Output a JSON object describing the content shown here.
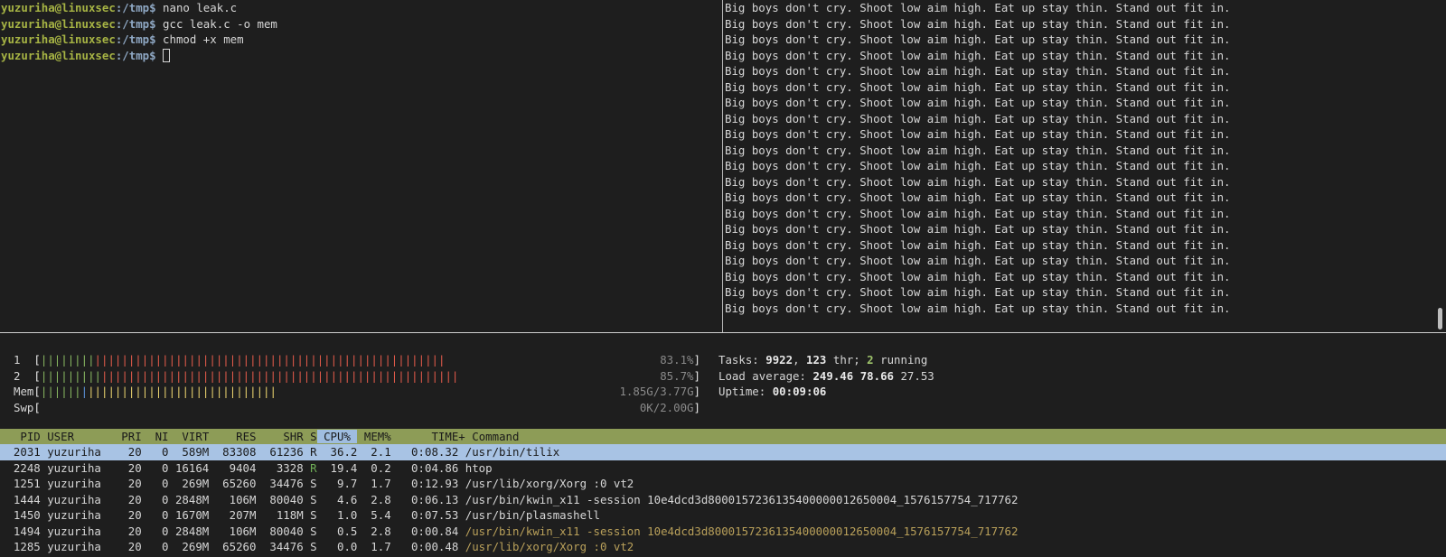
{
  "left_terminal": {
    "lines": [
      {
        "user": "yuzuriha@linuxsec",
        "path": ":/tmp",
        "cmd": "nano leak.c"
      },
      {
        "user": "yuzuriha@linuxsec",
        "path": ":/tmp",
        "cmd": "gcc leak.c -o mem"
      },
      {
        "user": "yuzuriha@linuxsec",
        "path": ":/tmp",
        "cmd": "chmod +x mem"
      },
      {
        "user": "yuzuriha@linuxsec",
        "path": ":/tmp",
        "cmd": ""
      }
    ],
    "prompt_symbol": "$"
  },
  "right_terminal": {
    "repeat_text": "Big boys don't cry. Shoot low aim high. Eat up stay thin. Stand out fit in.",
    "line_count": 20
  },
  "htop": {
    "meters": [
      {
        "label": "1",
        "value": "83.1%",
        "fill": 0.831
      },
      {
        "label": "2",
        "value": "85.7%",
        "fill": 0.857
      },
      {
        "label": "Mem",
        "value": "1.85G/3.77G",
        "fill": 0.49
      },
      {
        "label": "Swp",
        "value": "0K/2.00G",
        "fill": 0
      }
    ],
    "stats": {
      "tasks_label": "Tasks:",
      "tasks": "9922",
      "thr": "123",
      "thr_label": "thr;",
      "running": "2",
      "running_label": "running",
      "load_label": "Load average:",
      "load1": "249.46",
      "load5": "78.66",
      "load15": "27.53",
      "uptime_label": "Uptime:",
      "uptime": "00:09:06"
    },
    "columns": [
      "PID",
      "USER",
      "PRI",
      "NI",
      "VIRT",
      "RES",
      "SHR",
      "S",
      "CPU%",
      "MEM%",
      "TIME+",
      "Command"
    ],
    "sorted_column": "CPU%",
    "rows": [
      {
        "pid": "2031",
        "user": "yuzuriha",
        "pri": "20",
        "ni": "0",
        "virt": "589M",
        "res": "83308",
        "shr": "61236",
        "s": "R",
        "cpu": "36.2",
        "mem": "2.1",
        "time": "0:08.32",
        "cmd": "/usr/bin/tilix",
        "selected": true,
        "thread": false
      },
      {
        "pid": "2248",
        "user": "yuzuriha",
        "pri": "20",
        "ni": "0",
        "virt": "16164",
        "res": "9404",
        "shr": "3328",
        "s": "R",
        "cpu": "19.4",
        "mem": "0.2",
        "time": "0:04.86",
        "cmd": "htop",
        "selected": false,
        "thread": false
      },
      {
        "pid": "1251",
        "user": "yuzuriha",
        "pri": "20",
        "ni": "0",
        "virt": "269M",
        "res": "65260",
        "shr": "34476",
        "s": "S",
        "cpu": "9.7",
        "mem": "1.7",
        "time": "0:12.93",
        "cmd": "/usr/lib/xorg/Xorg :0 vt2",
        "selected": false,
        "thread": false
      },
      {
        "pid": "1444",
        "user": "yuzuriha",
        "pri": "20",
        "ni": "0",
        "virt": "2848M",
        "res": "106M",
        "shr": "80040",
        "s": "S",
        "cpu": "4.6",
        "mem": "2.8",
        "time": "0:06.13",
        "cmd": "/usr/bin/kwin_x11 -session 10e4dcd3d8000157236135400000012650004_1576157754_717762",
        "selected": false,
        "thread": false
      },
      {
        "pid": "1450",
        "user": "yuzuriha",
        "pri": "20",
        "ni": "0",
        "virt": "1670M",
        "res": "207M",
        "shr": "118M",
        "s": "S",
        "cpu": "1.0",
        "mem": "5.4",
        "time": "0:07.53",
        "cmd": "/usr/bin/plasmashell",
        "selected": false,
        "thread": false
      },
      {
        "pid": "1494",
        "user": "yuzuriha",
        "pri": "20",
        "ni": "0",
        "virt": "2848M",
        "res": "106M",
        "shr": "80040",
        "s": "S",
        "cpu": "0.5",
        "mem": "2.8",
        "time": "0:00.84",
        "cmd": "/usr/bin/kwin_x11 -session 10e4dcd3d8000157236135400000012650004_1576157754_717762",
        "selected": false,
        "thread": true
      },
      {
        "pid": "1285",
        "user": "yuzuriha",
        "pri": "20",
        "ni": "0",
        "virt": "269M",
        "res": "65260",
        "shr": "34476",
        "s": "S",
        "cpu": "0.0",
        "mem": "1.7",
        "time": "0:00.48",
        "cmd": "/usr/lib/xorg/Xorg :0 vt2",
        "selected": false,
        "thread": true
      }
    ]
  },
  "colors": {
    "background": "#1e1e1e",
    "prompt_user": "#a6b344",
    "prompt_path": "#8fa8c4",
    "header_bg": "#8d9c57",
    "selected_bg": "#a8c3e4",
    "sort_bg": "#9fbde0"
  }
}
